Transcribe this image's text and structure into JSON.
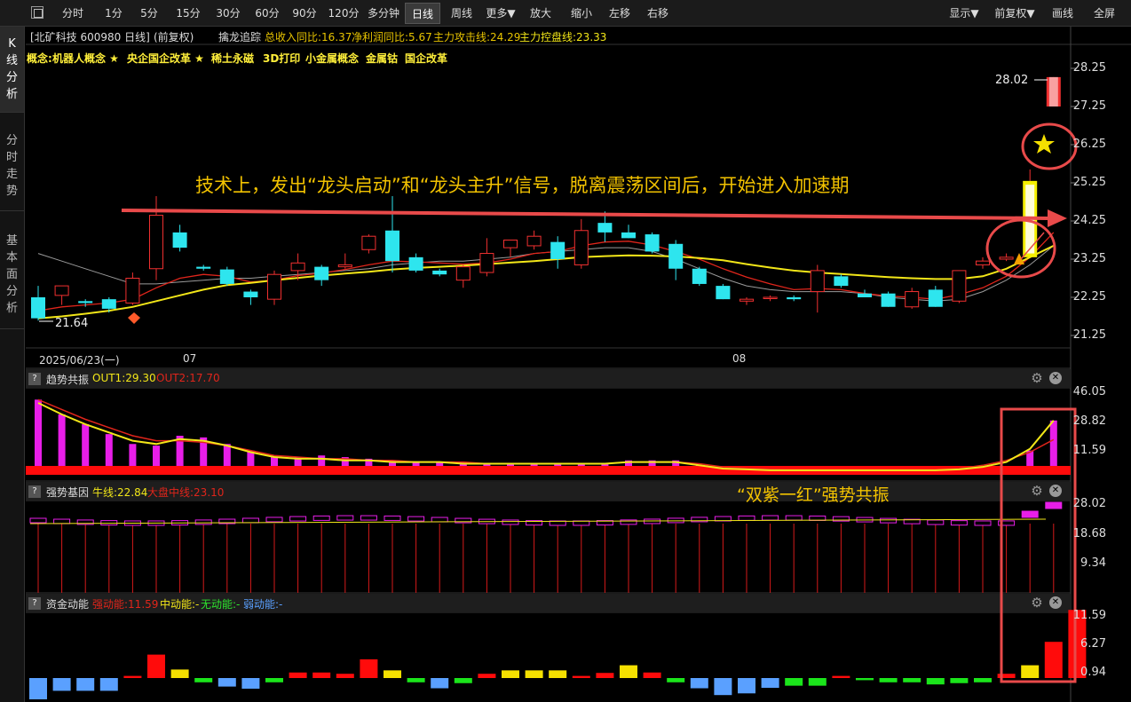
{
  "toolbar": {
    "periods": [
      "分时",
      "1分",
      "5分",
      "15分",
      "30分",
      "60分",
      "90分",
      "120分",
      "多分钟",
      "日线",
      "周线",
      "更多▼",
      "放大",
      "缩小",
      "左移",
      "右移"
    ],
    "active_period": "日线",
    "right": [
      "显示▼",
      "前复权▼",
      "画线",
      "全屏"
    ]
  },
  "sidebar": {
    "tabs": [
      "K线分析",
      "分时走势",
      "基本面分析"
    ],
    "active": "K线分析"
  },
  "info": {
    "stock": "[北矿科技 600980 日线]",
    "adjust": "(前复权)",
    "tracker": "擒龙追踪",
    "revenue": "总收入同比:16.37",
    "profit": "净利润同比:5.67",
    "attack": "主力攻击线:24.29",
    "control": "主力控盘线:23.33"
  },
  "concepts": {
    "label": "概念:",
    "items": [
      "机器人概念 ★",
      "央企国企改革 ★",
      "稀土永磁",
      "3D打印",
      "小金属概念",
      "金属钴",
      "国企改革"
    ]
  },
  "price_axis": [
    "28.25",
    "27.25",
    "26.25",
    "25.25",
    "24.25",
    "23.25",
    "22.25",
    "21.25"
  ],
  "date_axis": [
    "2025/06/23(一)",
    "07",
    "08"
  ],
  "labels": {
    "high": "28.02",
    "low": "21.64"
  },
  "annotations": {
    "main": "技术上，发出“龙头启动”和“龙头主升”信号，脱离震荡区间后，开始进入加速期",
    "sub": "“双紫一红”强势共振"
  },
  "panel1": {
    "name": "趋势共振",
    "out1": "OUT1:29.30",
    "out2": "OUT2:17.70",
    "axis": [
      "46.05",
      "28.82",
      "11.59"
    ]
  },
  "panel2": {
    "name": "强势基因",
    "bull": "牛线:22.84",
    "big": "大盘中线:23.10",
    "axis": [
      "28.02",
      "18.68",
      "9.34"
    ]
  },
  "panel3": {
    "name": "资金动能",
    "strong": "强动能:11.59",
    "mid": "中动能:-",
    "none": "无动能:-",
    "weak": "弱动能:-",
    "axis": [
      "11.59",
      "6.27",
      "0.94"
    ]
  },
  "colors": {
    "up": "#f03030",
    "down": "#2ee5ee",
    "ma_yellow": "#f2e618",
    "ma_red": "#e0251b",
    "ma_gray": "#9a9a9a",
    "magenta": "#e81ee8",
    "accent": "#f2c200"
  },
  "chart_data": {
    "type": "candlestick",
    "ylim": [
      21.0,
      28.6
    ],
    "candles": [
      {
        "o": 22.25,
        "h": 22.55,
        "l": 21.64,
        "c": 21.7
      },
      {
        "o": 22.3,
        "h": 22.55,
        "l": 22.05,
        "c": 22.55
      },
      {
        "o": 22.15,
        "h": 22.2,
        "l": 22.0,
        "c": 22.1
      },
      {
        "o": 22.2,
        "h": 22.25,
        "l": 21.85,
        "c": 21.95
      },
      {
        "o": 22.1,
        "h": 22.9,
        "l": 22.05,
        "c": 22.75
      },
      {
        "o": 23.0,
        "h": 24.9,
        "l": 22.7,
        "c": 24.4
      },
      {
        "o": 23.95,
        "h": 24.15,
        "l": 23.45,
        "c": 23.55
      },
      {
        "o": 23.05,
        "h": 23.1,
        "l": 22.95,
        "c": 23.0
      },
      {
        "o": 22.98,
        "h": 23.05,
        "l": 22.55,
        "c": 22.6
      },
      {
        "o": 22.4,
        "h": 22.45,
        "l": 22.05,
        "c": 22.25
      },
      {
        "o": 22.2,
        "h": 22.95,
        "l": 22.05,
        "c": 22.85
      },
      {
        "o": 22.95,
        "h": 23.4,
        "l": 22.7,
        "c": 23.15
      },
      {
        "o": 23.05,
        "h": 23.1,
        "l": 22.55,
        "c": 22.7
      },
      {
        "o": 23.05,
        "h": 23.4,
        "l": 23.0,
        "c": 23.1
      },
      {
        "o": 23.5,
        "h": 23.9,
        "l": 23.4,
        "c": 23.85
      },
      {
        "o": 24.0,
        "h": 24.9,
        "l": 22.9,
        "c": 23.2
      },
      {
        "o": 23.3,
        "h": 23.4,
        "l": 22.9,
        "c": 22.95
      },
      {
        "o": 22.95,
        "h": 23.0,
        "l": 22.8,
        "c": 22.85
      },
      {
        "o": 22.7,
        "h": 23.1,
        "l": 22.5,
        "c": 23.05
      },
      {
        "o": 22.9,
        "h": 23.8,
        "l": 22.8,
        "c": 23.4
      },
      {
        "o": 23.55,
        "h": 23.75,
        "l": 23.3,
        "c": 23.75
      },
      {
        "o": 23.6,
        "h": 24.0,
        "l": 23.5,
        "c": 23.85
      },
      {
        "o": 23.7,
        "h": 23.85,
        "l": 23.0,
        "c": 23.25
      },
      {
        "o": 23.1,
        "h": 24.3,
        "l": 23.0,
        "c": 24.0
      },
      {
        "o": 24.2,
        "h": 24.5,
        "l": 23.7,
        "c": 23.95
      },
      {
        "o": 23.95,
        "h": 24.15,
        "l": 23.8,
        "c": 23.8
      },
      {
        "o": 23.9,
        "h": 23.95,
        "l": 23.4,
        "c": 23.45
      },
      {
        "o": 23.65,
        "h": 23.75,
        "l": 22.7,
        "c": 23.0
      },
      {
        "o": 23.0,
        "h": 23.05,
        "l": 22.55,
        "c": 22.6
      },
      {
        "o": 22.55,
        "h": 22.6,
        "l": 22.2,
        "c": 22.2
      },
      {
        "o": 22.15,
        "h": 22.25,
        "l": 22.05,
        "c": 22.2
      },
      {
        "o": 22.22,
        "h": 22.3,
        "l": 22.15,
        "c": 22.25
      },
      {
        "o": 22.25,
        "h": 22.3,
        "l": 22.15,
        "c": 22.2
      },
      {
        "o": 22.4,
        "h": 23.1,
        "l": 21.85,
        "c": 22.95
      },
      {
        "o": 22.8,
        "h": 22.85,
        "l": 22.5,
        "c": 22.55
      },
      {
        "o": 22.35,
        "h": 22.45,
        "l": 22.25,
        "c": 22.25
      },
      {
        "o": 22.35,
        "h": 22.4,
        "l": 22.0,
        "c": 22.0
      },
      {
        "o": 22.0,
        "h": 22.5,
        "l": 21.95,
        "c": 22.4
      },
      {
        "o": 22.45,
        "h": 22.55,
        "l": 22.0,
        "c": 22.0
      },
      {
        "o": 22.15,
        "h": 22.95,
        "l": 22.1,
        "c": 22.95
      },
      {
        "o": 23.1,
        "h": 23.3,
        "l": 23.0,
        "c": 23.2
      },
      {
        "o": 23.25,
        "h": 23.4,
        "l": 23.2,
        "c": 23.3
      },
      {
        "o": 25.3,
        "h": 25.6,
        "l": 25.3,
        "c": 25.6
      },
      {
        "o": 27.3,
        "h": 28.02,
        "l": 27.3,
        "c": 28.02
      }
    ],
    "ma_yellow": [
      21.7,
      21.75,
      21.82,
      21.9,
      22.0,
      22.15,
      22.3,
      22.45,
      22.57,
      22.63,
      22.7,
      22.76,
      22.82,
      22.87,
      22.92,
      22.98,
      23.02,
      23.05,
      23.08,
      23.12,
      23.16,
      23.2,
      23.25,
      23.3,
      23.33,
      23.35,
      23.34,
      23.32,
      23.28,
      23.22,
      23.12,
      23.03,
      22.95,
      22.9,
      22.86,
      22.82,
      22.78,
      22.75,
      22.73,
      22.73,
      22.8,
      23.0,
      23.3,
      23.6
    ],
    "ma_red": [
      21.9,
      22.0,
      22.05,
      22.1,
      22.2,
      22.5,
      22.75,
      22.85,
      22.8,
      22.65,
      22.7,
      22.82,
      22.88,
      22.98,
      23.1,
      23.2,
      23.18,
      23.15,
      23.12,
      23.15,
      23.25,
      23.4,
      23.45,
      23.6,
      23.7,
      23.72,
      23.62,
      23.45,
      23.25,
      23.0,
      22.78,
      22.6,
      22.45,
      22.48,
      22.45,
      22.35,
      22.28,
      22.25,
      22.2,
      22.32,
      22.5,
      22.8,
      23.3,
      23.95
    ],
    "ma_gray": [
      23.4,
      23.2,
      23.0,
      22.8,
      22.6,
      22.6,
      22.65,
      22.7,
      22.75,
      22.75,
      22.8,
      22.85,
      22.9,
      22.95,
      23.0,
      23.1,
      23.15,
      23.2,
      23.2,
      23.25,
      23.3,
      23.4,
      23.45,
      23.5,
      23.55,
      23.55,
      23.45,
      23.25,
      23.0,
      22.75,
      22.55,
      22.45,
      22.4,
      22.4,
      22.4,
      22.35,
      22.25,
      22.2,
      22.15,
      22.2,
      22.4,
      22.7,
      23.1,
      23.6
    ],
    "panel1_bars": [
      42,
      33,
      27,
      21,
      15,
      14,
      20,
      19,
      15,
      11,
      7,
      7,
      8,
      7,
      6,
      5,
      4,
      4,
      4,
      3,
      3,
      3,
      3,
      3,
      3,
      5,
      5,
      5,
      2,
      0,
      0,
      0,
      0,
      0,
      0,
      0,
      0,
      0,
      0,
      0,
      0,
      0,
      11,
      29.3
    ],
    "panel1_out1": [
      40,
      33,
      27,
      22,
      17,
      15,
      18,
      17,
      14,
      10,
      7,
      6,
      6,
      5,
      5,
      4,
      4,
      4,
      3,
      3,
      3,
      3,
      3,
      3,
      3,
      4,
      4,
      4,
      2,
      0,
      -0.5,
      -1,
      -1,
      -1,
      -1,
      -1,
      -1,
      -1,
      -1,
      -0.5,
      1,
      4,
      12,
      29.3
    ],
    "panel1_out2": [
      42,
      36,
      30,
      25,
      20,
      17,
      17,
      16,
      14,
      11,
      8,
      7,
      6,
      6,
      5,
      5,
      4,
      4,
      4,
      3,
      3,
      3,
      3,
      3,
      3,
      4,
      4,
      4,
      3,
      1,
      0,
      -0.5,
      -1,
      -1,
      -1,
      -1,
      -1,
      -1,
      -1,
      0,
      2,
      5,
      10,
      17.7
    ],
    "panel3_bars": [
      -5,
      -3,
      -3,
      -3,
      0.5,
      5.5,
      2,
      -1,
      -2,
      -2.5,
      -1,
      1.3,
      1.3,
      1,
      4.4,
      1.8,
      -1,
      -2.4,
      -1.2,
      1,
      1.8,
      1.8,
      1.8,
      0.5,
      1.2,
      3,
      1.3,
      -1,
      -2.4,
      -4,
      -3.6,
      -2.3,
      -1.8,
      -1.8,
      0.5,
      -0.5,
      -1,
      -1,
      -1.5,
      -1.2,
      -1,
      1,
      3,
      8.5,
      16
    ]
  }
}
